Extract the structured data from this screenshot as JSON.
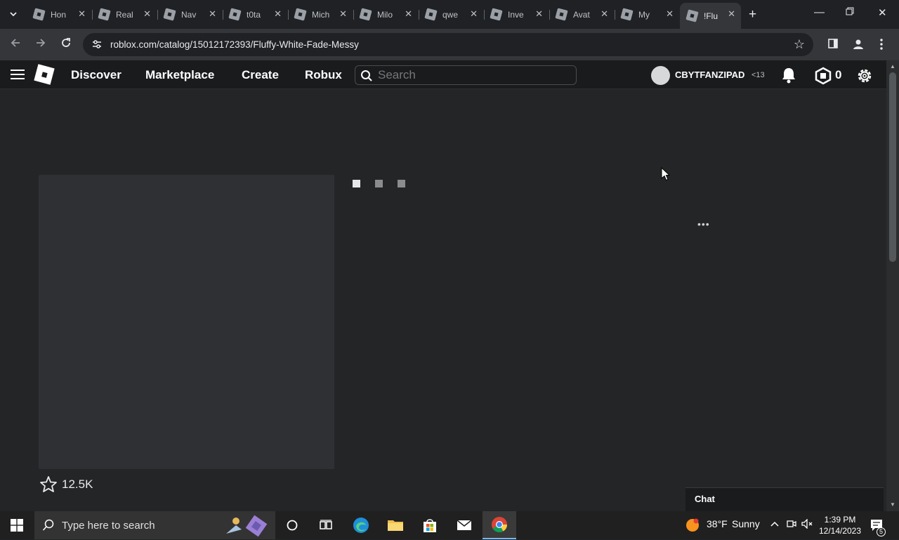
{
  "browser": {
    "tabs": [
      {
        "title": "Hon",
        "active": false
      },
      {
        "title": "Real",
        "active": false
      },
      {
        "title": "Nav",
        "active": false
      },
      {
        "title": "t0ta",
        "active": false
      },
      {
        "title": "Mich",
        "active": false
      },
      {
        "title": "Milo",
        "active": false
      },
      {
        "title": "qwe",
        "active": false
      },
      {
        "title": "Inve",
        "active": false
      },
      {
        "title": "Avat",
        "active": false
      },
      {
        "title": "My",
        "active": false
      },
      {
        "title": "!Flu",
        "active": true
      }
    ],
    "url": "roblox.com/catalog/15012172393/Fluffy-White-Fade-Messy"
  },
  "header": {
    "nav": [
      "Discover",
      "Marketplace",
      "Create",
      "Robux"
    ],
    "search_placeholder": "Search",
    "username": "CBYTFANZIPAD",
    "age_label": "<13",
    "robux_balance": "0"
  },
  "item": {
    "favorites": "12.5K",
    "more_label": "•••"
  },
  "chat": {
    "label": "Chat"
  },
  "taskbar": {
    "search_placeholder": "Type here to search",
    "weather": {
      "temp": "38°F",
      "condition": "Sunny"
    },
    "time": "1:39 PM",
    "date": "12/14/2023",
    "notifications": "5"
  },
  "colors": {
    "page_bg": "#232527",
    "header_bg": "#191b1d",
    "placeholder_box": "#2e3033"
  }
}
